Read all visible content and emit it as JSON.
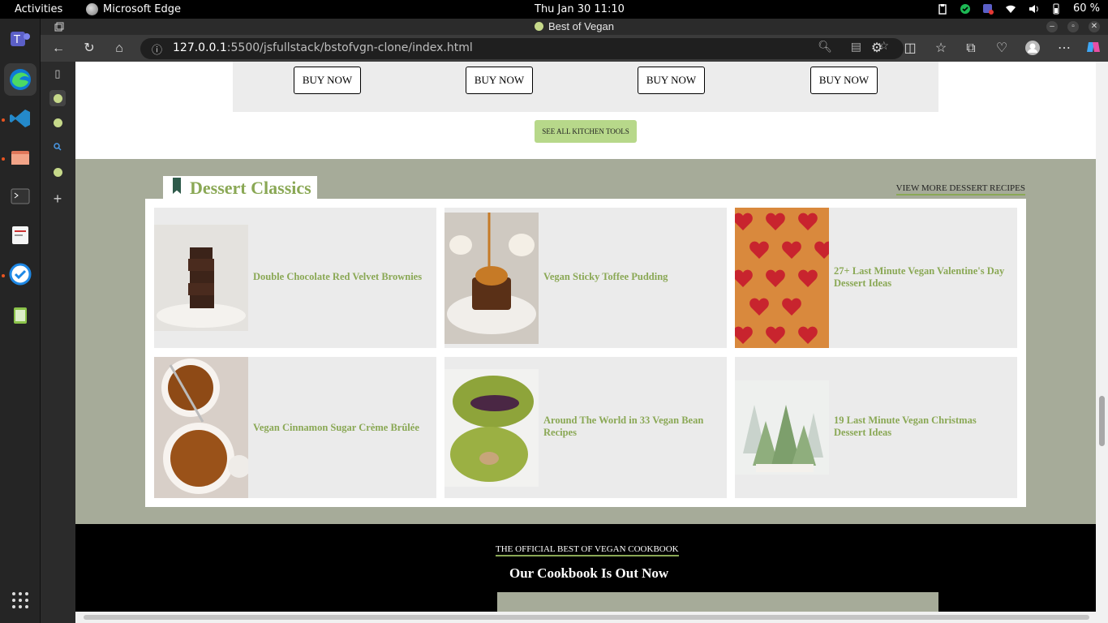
{
  "system": {
    "activities": "Activities",
    "app_name": "Microsoft Edge",
    "clock": "Thu Jan 30  11:10",
    "battery": "60 %"
  },
  "browser": {
    "window_title": "Best of Vegan",
    "url_host": "127.0.0.1",
    "url_path": ":5500/jsfullstack/bstofvgn-clone/index.html"
  },
  "tools": {
    "buy_labels": [
      "BUY NOW",
      "BUY NOW",
      "BUY NOW",
      "BUY NOW"
    ],
    "see_all": "SEE ALL KITCHEN TOOLS"
  },
  "dessert": {
    "heading": "Dessert Classics",
    "view_more": "VIEW MORE DESSERT RECIPES",
    "cards": [
      {
        "title": "Double Chocolate Red Velvet Brownies",
        "image": "brownie-stack"
      },
      {
        "title": "Vegan Sticky Toffee Pudding",
        "image": "toffee-pudding"
      },
      {
        "title": "27+ Last Minute Vegan Valentine's Day Dessert Ideas",
        "image": "strawberry-hearts"
      },
      {
        "title": "Vegan Cinnamon Sugar Crème Brûlée",
        "image": "creme-brulee"
      },
      {
        "title": "Around The World in 33 Vegan Bean Recipes",
        "image": "matcha-buns"
      },
      {
        "title": "19 Last Minute Vegan Christmas Dessert Ideas",
        "image": "christmas-trees"
      }
    ]
  },
  "cookbook": {
    "kicker": "THE OFFICIAL BEST OF VEGAN COOKBOOK",
    "title": "Our Cookbook Is Out Now"
  },
  "colors": {
    "accent_green": "#8aa855",
    "button_green": "#b7d88a",
    "section_bg": "#a6ab99"
  }
}
